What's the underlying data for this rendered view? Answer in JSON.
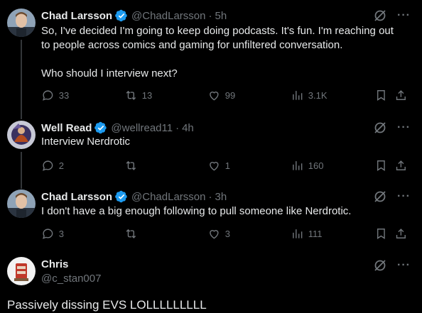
{
  "tweets": [
    {
      "name": "Chad Larsson",
      "handle": "@ChadLarsson",
      "sep": "·",
      "time": "5h",
      "text": "So, I've decided I'm going to keep doing podcasts. It's fun. I'm reaching out\nto people across comics and gaming for unfiltered conversation.\n\nWho should I interview next?",
      "replies": "33",
      "reposts": "13",
      "likes": "99",
      "views": "3.1K"
    },
    {
      "name": "Well Read",
      "handle": "@wellread11",
      "sep": "·",
      "time": "4h",
      "text": "Interview Nerdrotic",
      "replies": "2",
      "reposts": "",
      "likes": "1",
      "views": "160"
    },
    {
      "name": "Chad Larsson",
      "handle": "@ChadLarsson",
      "sep": "·",
      "time": "3h",
      "text": "I don't have a big enough following to pull someone like Nerdrotic.",
      "replies": "3",
      "reposts": "",
      "likes": "3",
      "views": "111"
    }
  ],
  "composer": {
    "name": "Chris",
    "handle": "@c_stan007",
    "text": "Passively dissing EVS LOLLLLLLLLL"
  },
  "colors": {
    "verified": "#1d9bf0",
    "muted": "#71767b",
    "text": "#e7e9ea",
    "background": "#000000"
  },
  "icons": [
    "verified-badge-icon",
    "grok-icon",
    "more-icon",
    "reply-icon",
    "repost-icon",
    "like-icon",
    "views-icon",
    "bookmark-icon",
    "share-icon"
  ]
}
